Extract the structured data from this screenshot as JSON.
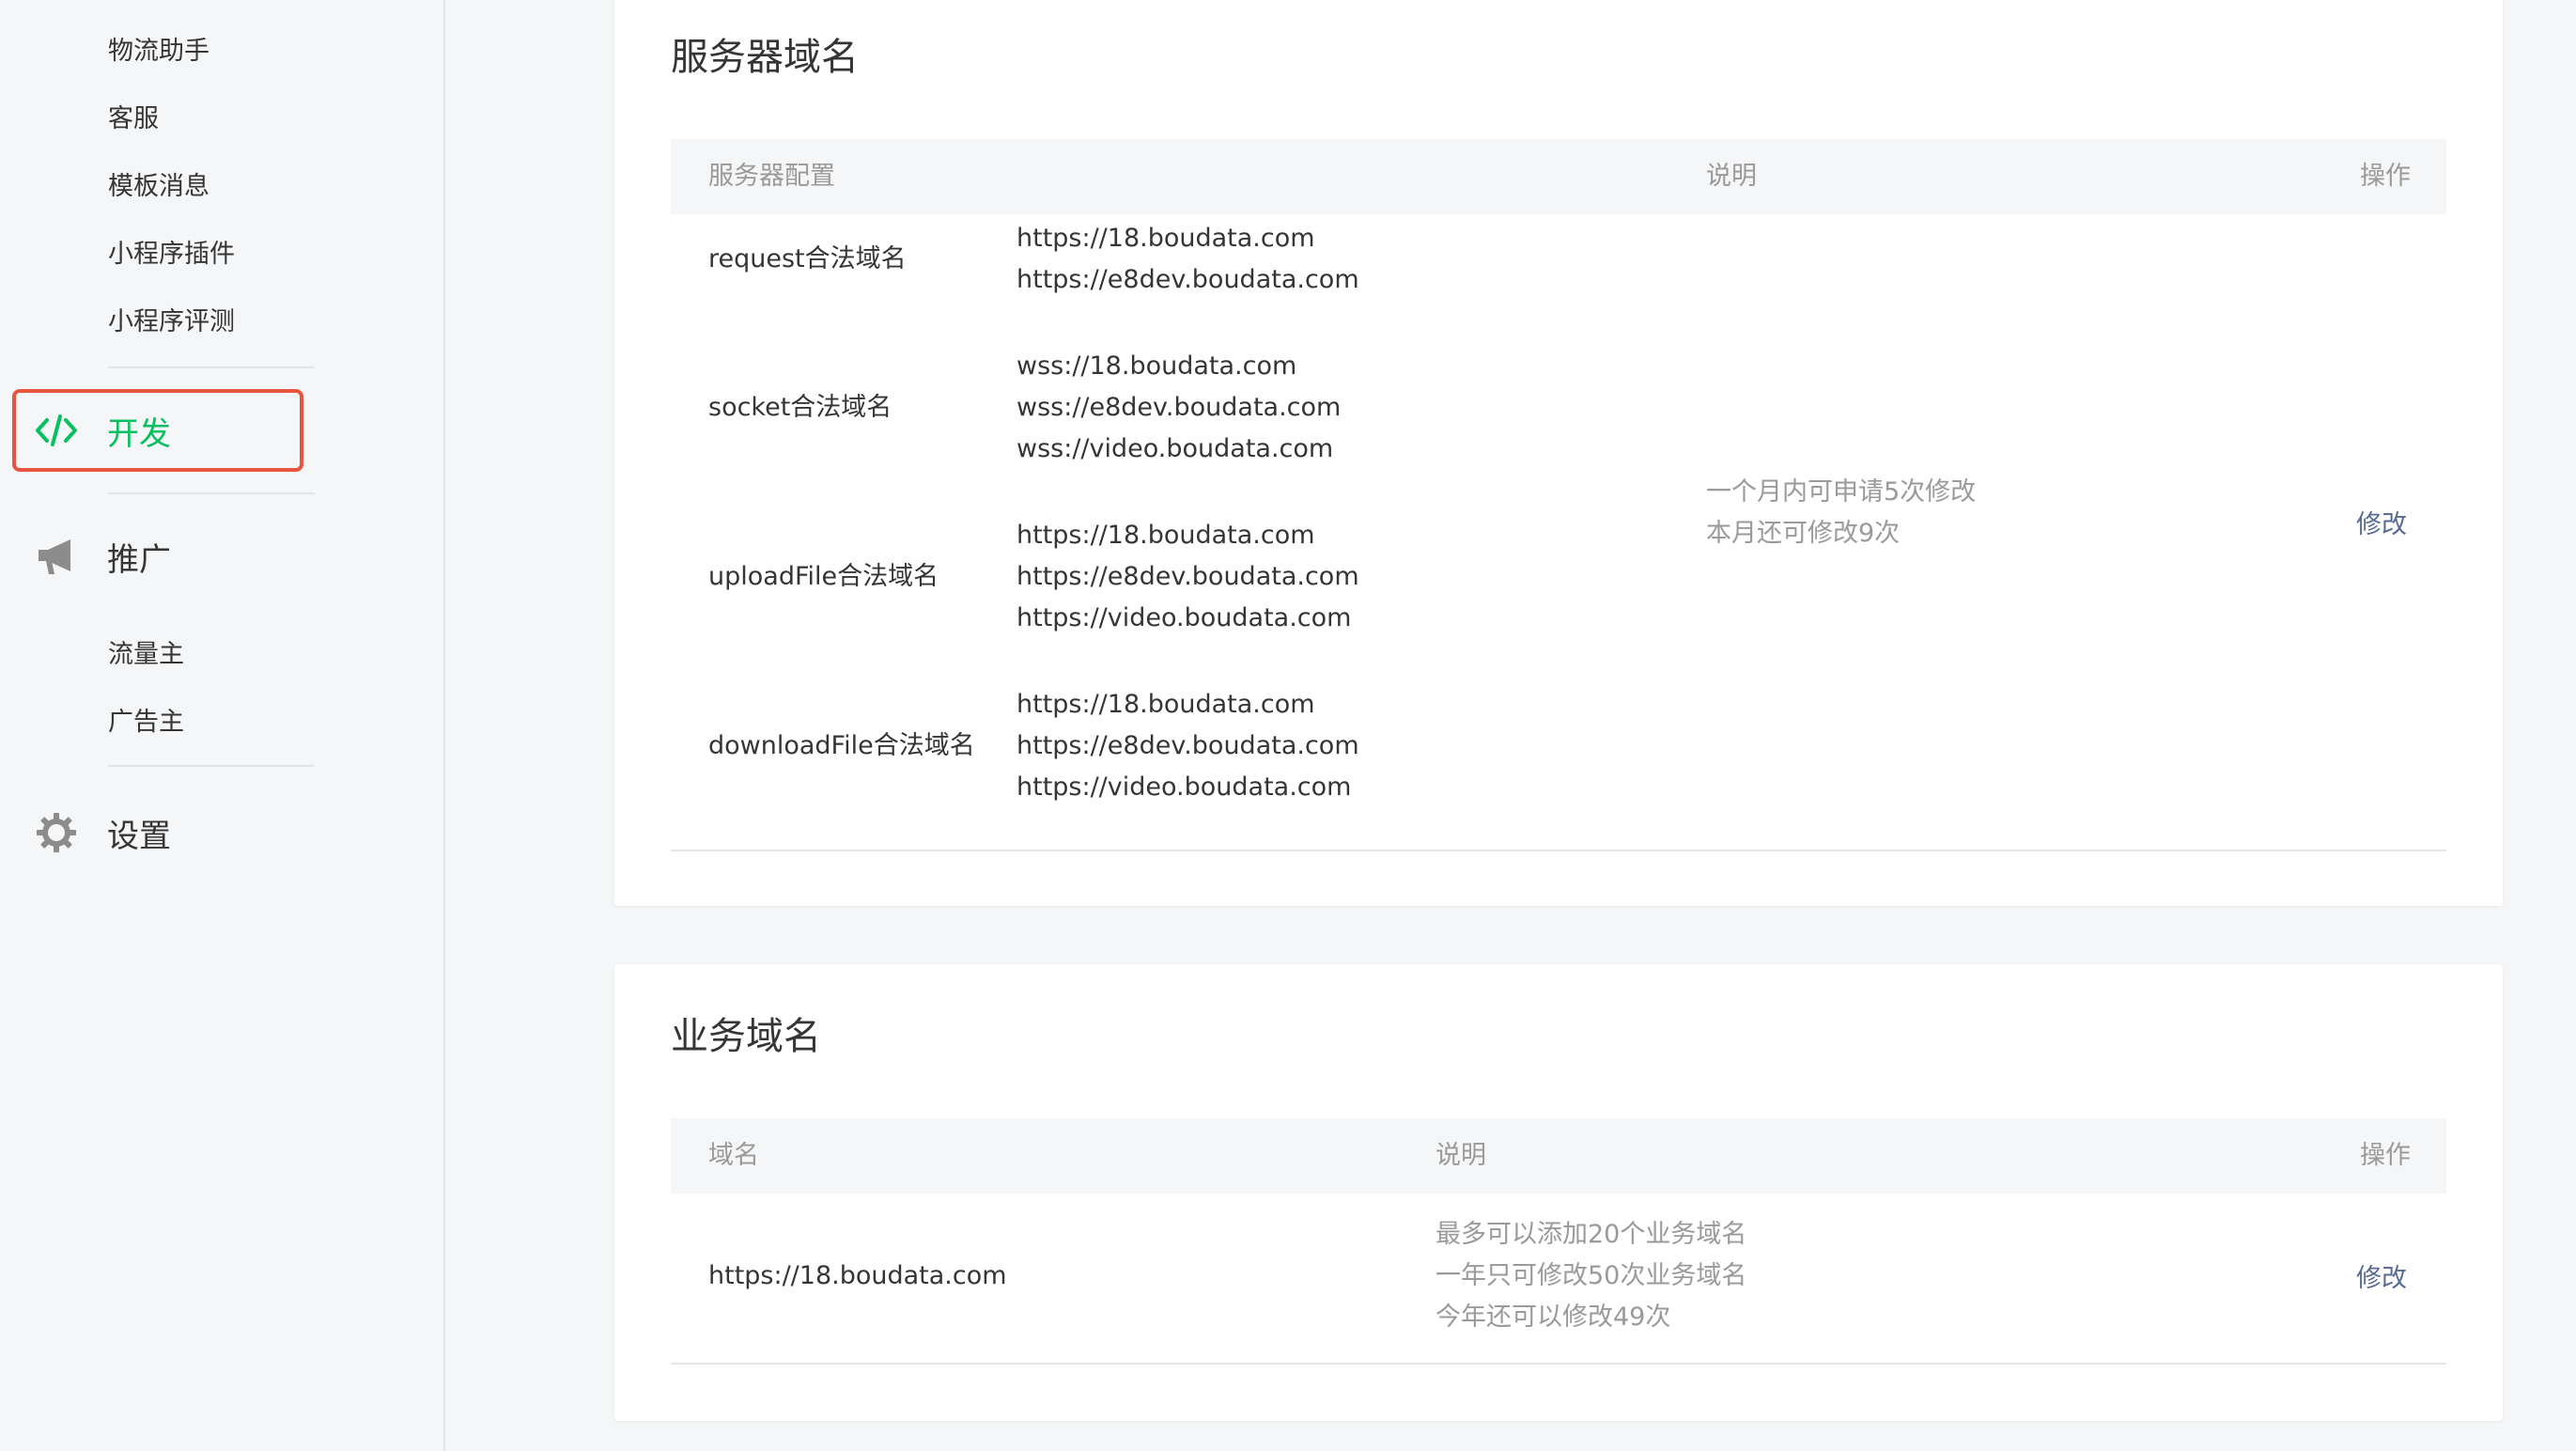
{
  "sidebar": {
    "sub_items_top": [
      "物流助手",
      "客服",
      "模板消息",
      "小程序插件",
      "小程序评测"
    ],
    "dev": {
      "label": "开发",
      "icon": "code-icon",
      "active_color": "#07c160"
    },
    "promote": {
      "label": "推广",
      "icon": "megaphone-icon"
    },
    "promote_items": [
      "流量主",
      "广告主"
    ],
    "settings": {
      "label": "设置",
      "icon": "gear-icon"
    }
  },
  "server_domain": {
    "title": "服务器域名",
    "headers": {
      "config": "服务器配置",
      "desc": "说明",
      "action": "操作"
    },
    "rows": [
      {
        "name": "request合法域名",
        "domains": [
          "https://18.boudata.com",
          "https://e8dev.boudata.com"
        ]
      },
      {
        "name": "socket合法域名",
        "domains": [
          "wss://18.boudata.com",
          "wss://e8dev.boudata.com",
          "wss://video.boudata.com"
        ]
      },
      {
        "name": "uploadFile合法域名",
        "domains": [
          "https://18.boudata.com",
          "https://e8dev.boudata.com",
          "https://video.boudata.com"
        ]
      },
      {
        "name": "downloadFile合法域名",
        "domains": [
          "https://18.boudata.com",
          "https://e8dev.boudata.com",
          "https://video.boudata.com"
        ]
      }
    ],
    "desc_lines": [
      "一个月内可申请5次修改",
      "本月还可修改9次"
    ],
    "action": "修改"
  },
  "business_domain": {
    "title": "业务域名",
    "headers": {
      "domain": "域名",
      "desc": "说明",
      "action": "操作"
    },
    "domain": "https://18.boudata.com",
    "desc_lines": [
      "最多可以添加20个业务域名",
      "一年只可修改50次业务域名",
      "今年还可以修改49次"
    ],
    "action": "修改"
  },
  "colors": {
    "accent": "#07c160",
    "link": "#576b95",
    "highlight": "#e8543e"
  }
}
